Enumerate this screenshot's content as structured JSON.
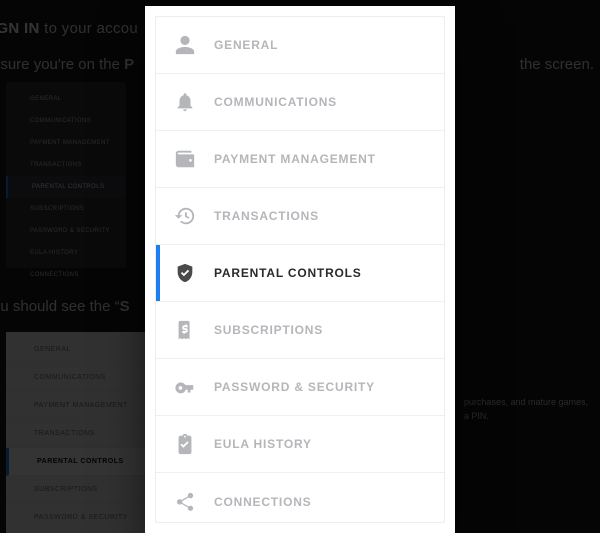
{
  "backdrop": {
    "line1_prefix": "IGN IN",
    "line1_rest": " to your accou",
    "line2_left": "nsure you're on the ",
    "line2_bold": "P",
    "line2_right": "the screen.",
    "line3_left": "ou should see the “",
    "line3_bold": "S",
    "note_a": "purchases, and mature games,",
    "note_b": "a PIN.",
    "mini_items": [
      "GENERAL",
      "COMMUNICATIONS",
      "PAYMENT MANAGEMENT",
      "TRANSACTIONS",
      "PARENTAL CONTROLS",
      "SUBSCRIPTIONS",
      "PASSWORD & SECURITY",
      "EULA HISTORY",
      "CONNECTIONS"
    ],
    "mini_selected_index": 4,
    "panel_items": [
      "GENERAL",
      "COMMUNICATIONS",
      "PAYMENT MANAGEMENT",
      "TRANSACTIONS",
      "PARENTAL CONTROLS",
      "SUBSCRIPTIONS",
      "PASSWORD & SECURITY"
    ],
    "panel_selected_index": 4
  },
  "menu": {
    "selected_index": 4,
    "items": [
      {
        "id": "general",
        "label": "GENERAL",
        "icon": "person-icon"
      },
      {
        "id": "communications",
        "label": "COMMUNICATIONS",
        "icon": "bell-icon"
      },
      {
        "id": "payment-management",
        "label": "PAYMENT MANAGEMENT",
        "icon": "wallet-icon"
      },
      {
        "id": "transactions",
        "label": "TRANSACTIONS",
        "icon": "history-icon"
      },
      {
        "id": "parental-controls",
        "label": "PARENTAL CONTROLS",
        "icon": "shield-check-icon"
      },
      {
        "id": "subscriptions",
        "label": "SUBSCRIPTIONS",
        "icon": "receipt-icon"
      },
      {
        "id": "password-security",
        "label": "PASSWORD & SECURITY",
        "icon": "key-icon"
      },
      {
        "id": "eula-history",
        "label": "EULA HISTORY",
        "icon": "clipboard-icon"
      },
      {
        "id": "connections",
        "label": "CONNECTIONS",
        "icon": "share-icon"
      }
    ]
  },
  "colors": {
    "accent": "#1f7df2"
  }
}
